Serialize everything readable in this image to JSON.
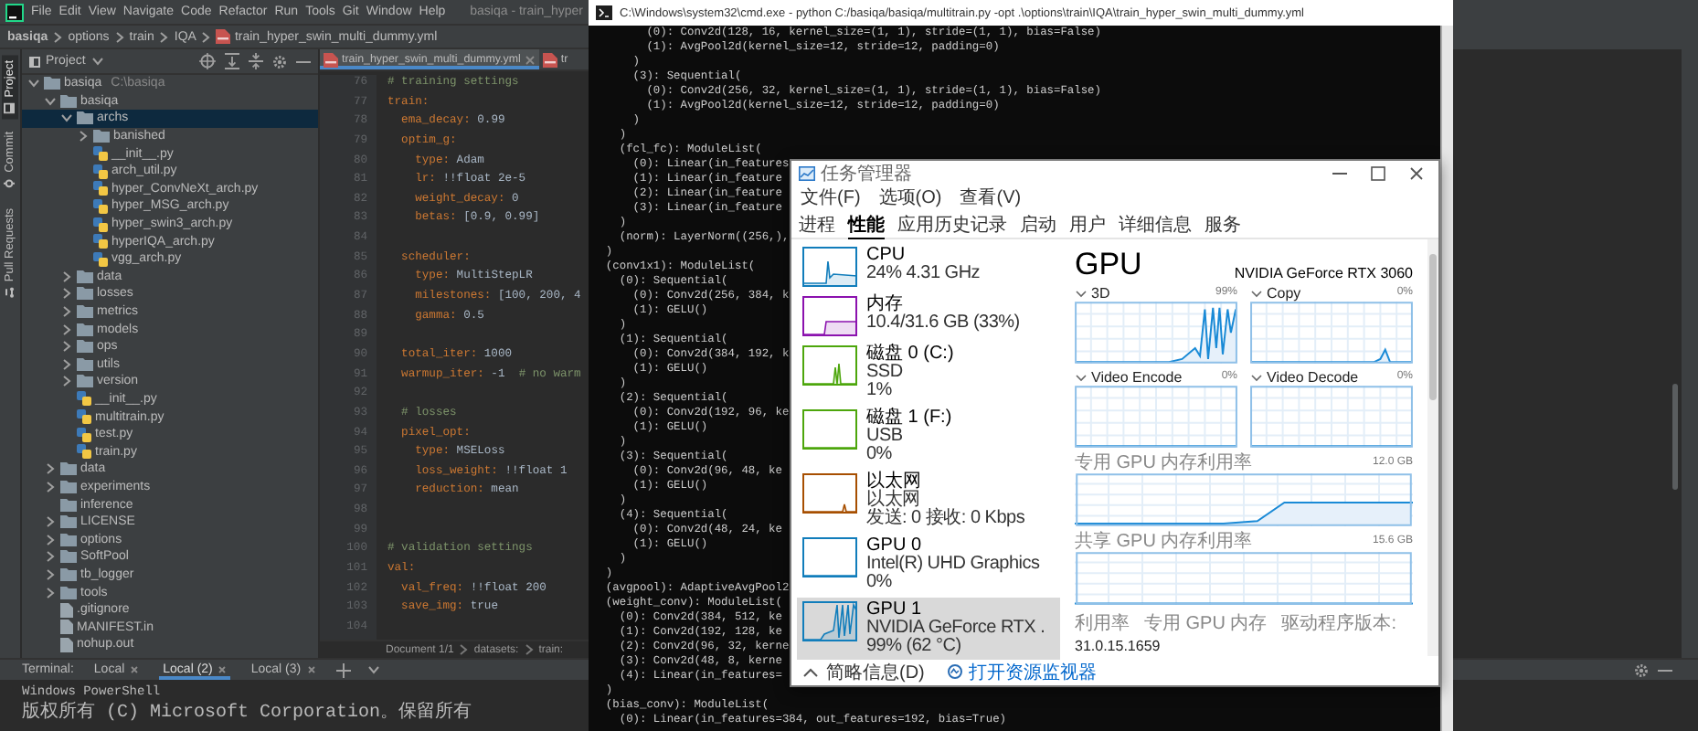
{
  "ide": {
    "menu": [
      "File",
      "Edit",
      "View",
      "Navigate",
      "Code",
      "Refactor",
      "Run",
      "Tools",
      "Git",
      "Window",
      "Help"
    ],
    "title": "basiqa - train_hyper",
    "breadcrumb": [
      "basiqa",
      "options",
      "train",
      "IQA",
      "train_hyper_swin_multi_dummy.yml"
    ],
    "side_tabs": [
      {
        "label": "Project",
        "selected": true
      },
      {
        "label": "Commit",
        "selected": false
      },
      {
        "label": "Pull Requests",
        "selected": false
      }
    ],
    "project": {
      "title": "Project",
      "tree": [
        {
          "kind": "folder",
          "name": "basiqa",
          "path": "C:\\basiqa",
          "expanded": true,
          "selected": false,
          "children": [
            {
              "kind": "folder",
              "name": "basiqa",
              "expanded": true,
              "selected": false,
              "children": [
                {
                  "kind": "folder",
                  "name": "archs",
                  "expanded": true,
                  "selected": true,
                  "children": [
                    {
                      "kind": "folder",
                      "name": "banished",
                      "expanded": false,
                      "selected": false
                    },
                    {
                      "kind": "python",
                      "name": "__init__.py",
                      "selected": false
                    },
                    {
                      "kind": "python",
                      "name": "arch_util.py",
                      "selected": false
                    },
                    {
                      "kind": "python",
                      "name": "hyper_ConvNeXt_arch.py",
                      "selected": false
                    },
                    {
                      "kind": "python",
                      "name": "hyper_MSG_arch.py",
                      "selected": false
                    },
                    {
                      "kind": "python",
                      "name": "hyper_swin3_arch.py",
                      "selected": false
                    },
                    {
                      "kind": "python",
                      "name": "hyperIQA_arch.py",
                      "selected": false
                    },
                    {
                      "kind": "python",
                      "name": "vgg_arch.py",
                      "selected": false
                    }
                  ]
                },
                {
                  "kind": "folder",
                  "name": "data",
                  "expanded": false,
                  "selected": false
                },
                {
                  "kind": "folder",
                  "name": "losses",
                  "expanded": false,
                  "selected": false
                },
                {
                  "kind": "folder",
                  "name": "metrics",
                  "expanded": false,
                  "selected": false
                },
                {
                  "kind": "folder",
                  "name": "models",
                  "expanded": false,
                  "selected": false
                },
                {
                  "kind": "folder",
                  "name": "ops",
                  "expanded": false,
                  "selected": false
                },
                {
                  "kind": "folder",
                  "name": "utils",
                  "expanded": false,
                  "selected": false
                },
                {
                  "kind": "folder",
                  "name": "version",
                  "expanded": false,
                  "selected": false
                },
                {
                  "kind": "python",
                  "name": "__init__.py",
                  "selected": false
                },
                {
                  "kind": "python",
                  "name": "multitrain.py",
                  "selected": false
                },
                {
                  "kind": "python",
                  "name": "test.py",
                  "selected": false
                },
                {
                  "kind": "python",
                  "name": "train.py",
                  "selected": false
                }
              ]
            },
            {
              "kind": "folder",
              "name": "data",
              "expanded": false,
              "selected": false
            },
            {
              "kind": "folder",
              "name": "experiments",
              "expanded": false,
              "selected": false
            },
            {
              "kind": "plainfolder",
              "name": "inference",
              "selected": false
            },
            {
              "kind": "folder",
              "name": "LICENSE",
              "expanded": false,
              "selected": false
            },
            {
              "kind": "folder",
              "name": "options",
              "expanded": false,
              "selected": false
            },
            {
              "kind": "folder",
              "name": "SoftPool",
              "expanded": false,
              "selected": false
            },
            {
              "kind": "folder",
              "name": "tb_logger",
              "expanded": false,
              "selected": false
            },
            {
              "kind": "folder",
              "name": "tools",
              "expanded": false,
              "selected": false
            },
            {
              "kind": "text",
              "name": ".gitignore",
              "selected": false
            },
            {
              "kind": "text",
              "name": "MANIFEST.in",
              "selected": false
            },
            {
              "kind": "text",
              "name": "nohup.out",
              "selected": false
            }
          ]
        }
      ]
    },
    "editor": {
      "tabs": [
        {
          "label": "train_hyper_swin_multi_dummy.yml",
          "selected": true
        },
        {
          "label": "tr",
          "selected": false
        }
      ],
      "lines": [
        {
          "number": "76",
          "parts": [
            {
              "kind": "comment",
              "text": "# training settings"
            }
          ]
        },
        {
          "number": "77",
          "parts": [
            {
              "kind": "key",
              "text": "train:"
            }
          ]
        },
        {
          "number": "78",
          "parts": [
            {
              "kind": "key",
              "text": "  ema_decay:"
            },
            {
              "kind": "value",
              "text": " 0.99"
            }
          ]
        },
        {
          "number": "79",
          "parts": [
            {
              "kind": "key",
              "text": "  optim_g:"
            }
          ]
        },
        {
          "number": "80",
          "parts": [
            {
              "kind": "key",
              "text": "    type:"
            },
            {
              "kind": "value",
              "text": " Adam"
            }
          ]
        },
        {
          "number": "81",
          "parts": [
            {
              "kind": "key",
              "text": "    lr:"
            },
            {
              "kind": "value",
              "text": " !!float 2e-5"
            }
          ]
        },
        {
          "number": "82",
          "parts": [
            {
              "kind": "key",
              "text": "    weight_decay:"
            },
            {
              "kind": "value",
              "text": " 0"
            }
          ]
        },
        {
          "number": "83",
          "parts": [
            {
              "kind": "key",
              "text": "    betas:"
            },
            {
              "kind": "value",
              "text": " [0.9, 0.99]"
            }
          ]
        },
        {
          "number": "84"
        },
        {
          "number": "85",
          "parts": [
            {
              "kind": "key",
              "text": "  scheduler:"
            }
          ]
        },
        {
          "number": "86",
          "parts": [
            {
              "kind": "key",
              "text": "    type:"
            },
            {
              "kind": "value",
              "text": " MultiStepLR"
            }
          ]
        },
        {
          "number": "87",
          "parts": [
            {
              "kind": "key",
              "text": "    milestones:"
            },
            {
              "kind": "value",
              "text": " [100, 200, 4"
            }
          ]
        },
        {
          "number": "88",
          "parts": [
            {
              "kind": "key",
              "text": "    gamma:"
            },
            {
              "kind": "value",
              "text": " 0.5"
            }
          ]
        },
        {
          "number": "89"
        },
        {
          "number": "90",
          "parts": [
            {
              "kind": "key",
              "text": "  total_iter:"
            },
            {
              "kind": "value",
              "text": " 1000"
            }
          ]
        },
        {
          "number": "91",
          "parts": [
            {
              "kind": "key",
              "text": "  warmup_iter:"
            },
            {
              "kind": "value",
              "text": " -1  "
            },
            {
              "kind": "comment",
              "text": "# no warm"
            }
          ]
        },
        {
          "number": "92"
        },
        {
          "number": "93",
          "parts": [
            {
              "kind": "comment",
              "text": "  # losses"
            }
          ]
        },
        {
          "number": "94",
          "parts": [
            {
              "kind": "key",
              "text": "  pixel_opt:"
            }
          ]
        },
        {
          "number": "95",
          "parts": [
            {
              "kind": "key",
              "text": "    type:"
            },
            {
              "kind": "value",
              "text": " MSELoss"
            }
          ]
        },
        {
          "number": "96",
          "parts": [
            {
              "kind": "key",
              "text": "    loss_weight:"
            },
            {
              "kind": "value",
              "text": " !!float 1"
            }
          ]
        },
        {
          "number": "97",
          "parts": [
            {
              "kind": "key",
              "text": "    reduction:"
            },
            {
              "kind": "value",
              "text": " mean"
            }
          ]
        },
        {
          "number": "98"
        },
        {
          "number": "99"
        },
        {
          "number": "100",
          "parts": [
            {
              "kind": "comment",
              "text": "# validation settings"
            }
          ]
        },
        {
          "number": "101",
          "parts": [
            {
              "kind": "key",
              "text": "val:"
            }
          ]
        },
        {
          "number": "102",
          "parts": [
            {
              "kind": "key",
              "text": "  val_freq:"
            },
            {
              "kind": "value",
              "text": " !!float 200"
            }
          ]
        },
        {
          "number": "103",
          "parts": [
            {
              "kind": "key",
              "text": "  save_img:"
            },
            {
              "kind": "value",
              "text": " true"
            }
          ]
        },
        {
          "number": "104"
        }
      ],
      "breadcrumb": [
        "Document 1/1",
        "datasets:",
        "train:"
      ]
    },
    "terminal": {
      "title": "Terminal:",
      "tabs": [
        {
          "label": "Local",
          "selected": false
        },
        {
          "label": "Local (2)",
          "selected": true
        },
        {
          "label": "Local (3)",
          "selected": false
        }
      ],
      "lines": [
        "Windows PowerShell",
        "版权所有 (C) Microsoft Corporation。保留所有"
      ]
    }
  },
  "cmd": {
    "title": "C:\\Windows\\system32\\cmd.exe - python  C:/basiqa/basiqa/multitrain.py -opt .\\options\\train\\IQA\\train_hyper_swin_multi_dummy.yml",
    "lines": [
      "        (0): Conv2d(128, 16, kernel_size=(1, 1), stride=(1, 1), bias=False)",
      "        (1): AvgPool2d(kernel_size=12, stride=12, padding=0)",
      "      )",
      "      (3): Sequential(",
      "        (0): Conv2d(256, 32, kernel_size=(1, 1), stride=(1, 1), bias=False)",
      "        (1): AvgPool2d(kernel_size=12, stride=12, padding=0)",
      "      )",
      "    )",
      "    (fcl_fc): ModuleList(",
      "      (0): Linear(in_features",
      "      (1): Linear(in_feature",
      "      (2): Linear(in_feature",
      "      (3): Linear(in_feature",
      "    )",
      "    (norm): LayerNorm((256,),",
      "  )",
      "  (conv1x1): ModuleList(",
      "    (0): Sequential(",
      "      (0): Conv2d(256, 384, k",
      "      (1): GELU()",
      "    )",
      "    (1): Sequential(",
      "      (0): Conv2d(384, 192, k",
      "      (1): GELU()",
      "    )",
      "    (2): Sequential(",
      "      (0): Conv2d(192, 96, ke",
      "      (1): GELU()",
      "    )",
      "    (3): Sequential(",
      "      (0): Conv2d(96, 48, ke",
      "      (1): GELU()",
      "    )",
      "    (4): Sequential(",
      "      (0): Conv2d(48, 24, ke",
      "      (1): GELU()",
      "    )",
      "  )",
      "  (avgpool): AdaptiveAvgPool2",
      "  (weight_conv): ModuleList(",
      "    (0): Conv2d(384, 512, ke",
      "    (1): Conv2d(192, 128, ke",
      "    (2): Conv2d(96, 32, kerne",
      "    (3): Conv2d(48, 8, kerne",
      "    (4): Linear(in_features=",
      "  )",
      "  (bias_conv): ModuleList(",
      "    (0): Linear(in_features=384, out_features=192, bias=True)"
    ]
  },
  "task_manager": {
    "title": "任务管理器",
    "menu": [
      "文件(F)",
      "选项(O)",
      "查看(V)"
    ],
    "tabs": [
      {
        "label": "进程",
        "selected": false
      },
      {
        "label": "性能",
        "selected": true
      },
      {
        "label": "应用历史记录",
        "selected": false
      },
      {
        "label": "启动",
        "selected": false
      },
      {
        "label": "用户",
        "selected": false
      },
      {
        "label": "详细信息",
        "selected": false
      },
      {
        "label": "服务",
        "selected": false
      }
    ],
    "resources": [
      {
        "title": "CPU",
        "lines": [
          "24% 4.31 GHz"
        ],
        "color": "#117dbb",
        "selected": false
      },
      {
        "title": "内存",
        "lines": [
          "10.4/31.6 GB (33%)"
        ],
        "color": "#8b12ae",
        "selected": false
      },
      {
        "title": "磁盘 0 (C:)",
        "lines": [
          "SSD",
          "1%"
        ],
        "color": "#4da60c",
        "selected": false
      },
      {
        "title": "磁盘 1 (F:)",
        "lines": [
          "USB",
          "0%"
        ],
        "color": "#4da60c",
        "selected": false
      },
      {
        "title": "以太网",
        "lines": [
          "以太网",
          "发送: 0 接收: 0 Kbps"
        ],
        "color": "#a74f01",
        "selected": false
      },
      {
        "title": "GPU 0",
        "lines": [
          "Intel(R) UHD Graphics",
          "0%"
        ],
        "color": "#117dbb",
        "selected": false
      },
      {
        "title": "GPU 1",
        "lines": [
          "NVIDIA GeForce RTX .",
          "99% (62 °C)"
        ],
        "color": "#117dbb",
        "selected": true
      }
    ],
    "detail": {
      "title": "GPU",
      "device": "NVIDIA GeForce RTX 3060",
      "engines": [
        {
          "label": "3D",
          "reading": "99%"
        },
        {
          "label": "Copy",
          "reading": "0%"
        },
        {
          "label": "Video Encode",
          "reading": "0%"
        },
        {
          "label": "Video Decode",
          "reading": "0%"
        }
      ],
      "memory": [
        {
          "label": "专用 GPU 内存利用率",
          "reading": "12.0 GB"
        },
        {
          "label": "共享 GPU 内存利用率",
          "reading": "15.6 GB"
        }
      ],
      "stats": [
        "利用率",
        "专用 GPU 内存",
        "驱动程序版本:"
      ],
      "driver_version": "31.0.15.1659"
    },
    "footer": {
      "toggle": "简略信息(D)",
      "link": "打开资源监视器"
    }
  }
}
